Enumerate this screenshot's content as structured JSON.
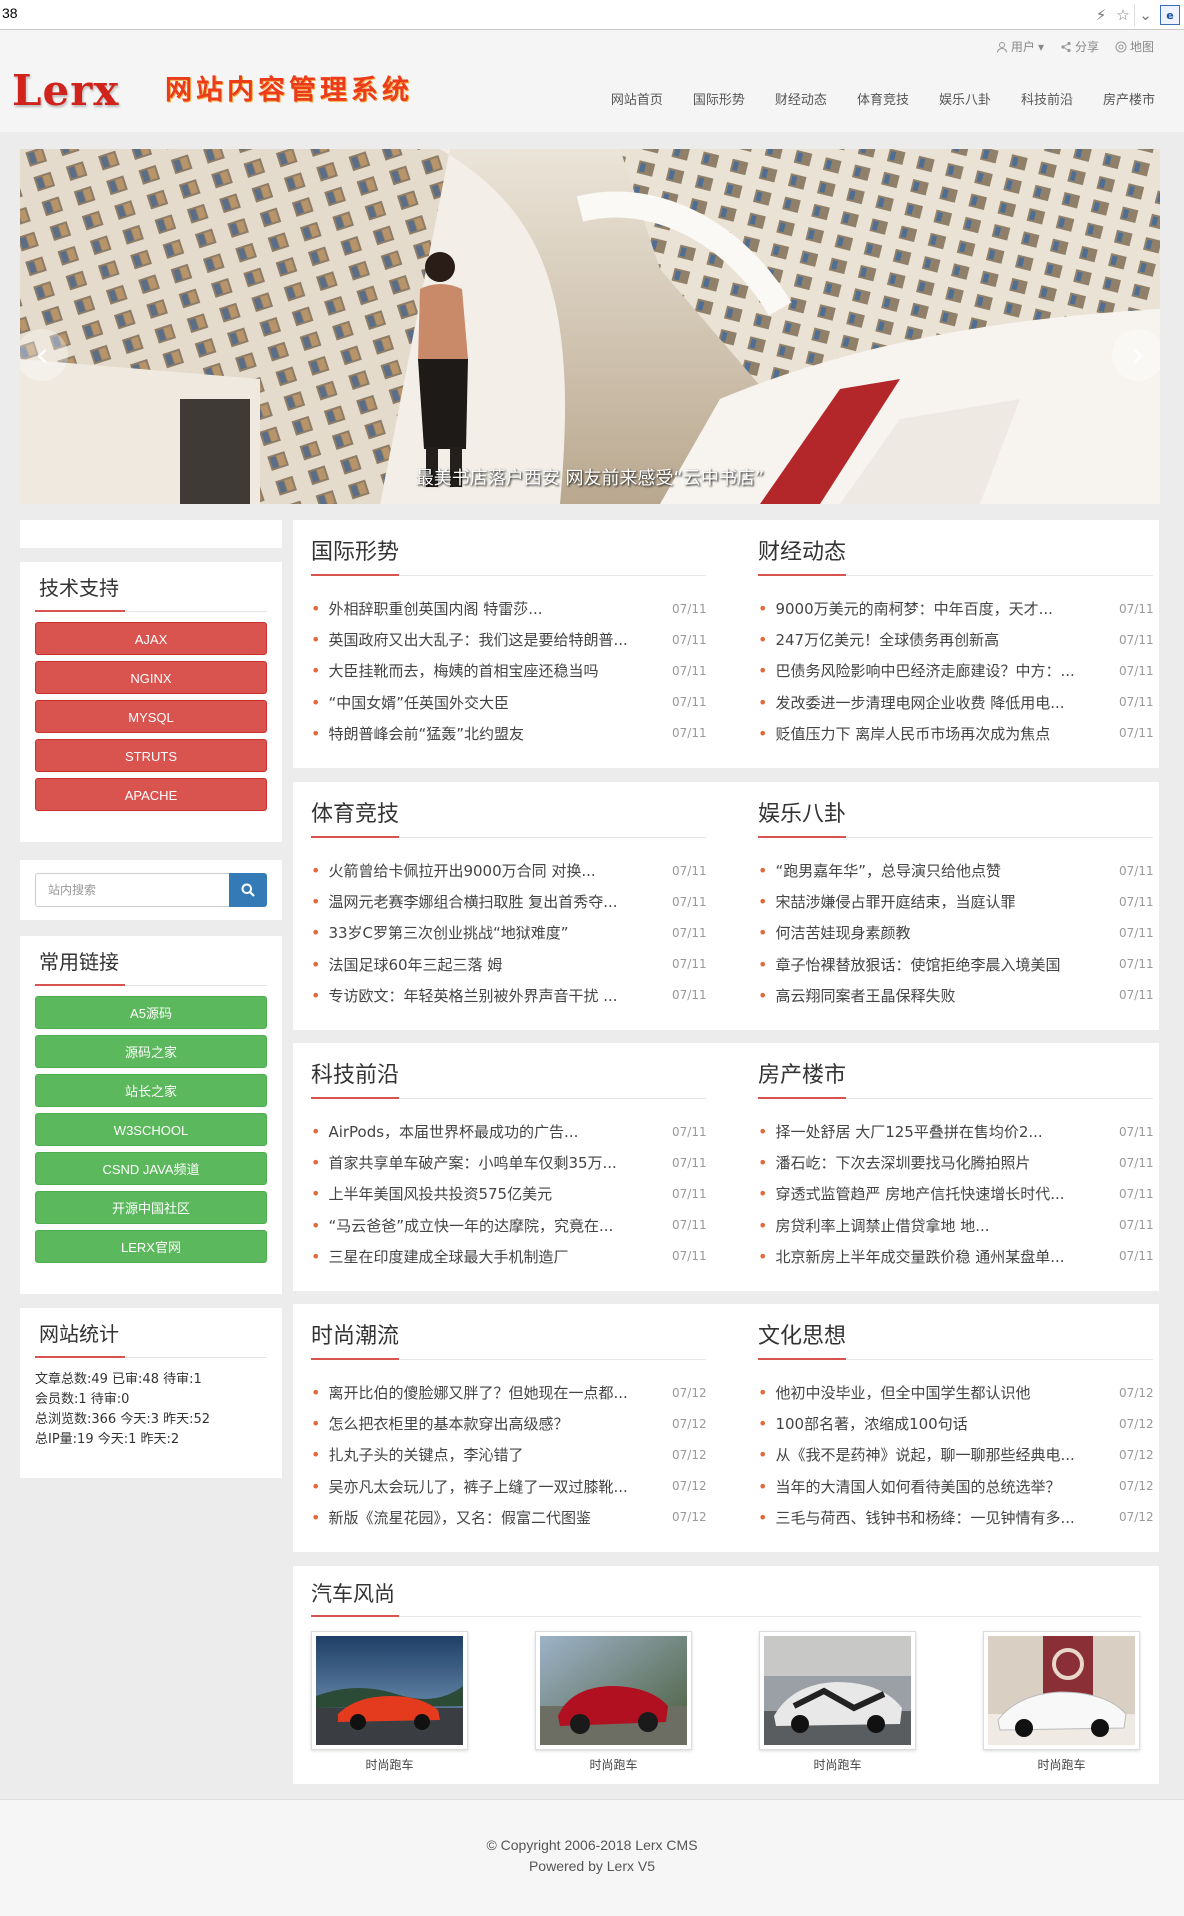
{
  "browser": {
    "url": "38",
    "icons": [
      "lightning-icon",
      "star-icon",
      "dropdown-icon",
      "ie-compat-icon"
    ]
  },
  "header": {
    "logo": "Lerx",
    "slogan": "网站内容管理系统",
    "topnav": {
      "user": "用户",
      "share": "分享",
      "map": "地图"
    },
    "nav": [
      "网站首页",
      "国际形势",
      "财经动态",
      "体育竞技",
      "娱乐八卦",
      "科技前沿",
      "房产楼市"
    ]
  },
  "banner": {
    "caption": "最美书店落户西安 网友前来感受“云中书店”"
  },
  "sidebar": {
    "tech": {
      "title": "技术支持",
      "items": [
        "AJAX",
        "NGINX",
        "MYSQL",
        "STRUTS",
        "APACHE"
      ]
    },
    "search": {
      "placeholder": "站内搜索"
    },
    "links": {
      "title": "常用链接",
      "items": [
        "A5源码",
        "源码之家",
        "站长之家",
        "W3SCHOOL",
        "CSND JAVA频道",
        "开源中国社区",
        "LERX官网"
      ]
    },
    "stats": {
      "title": "网站统计",
      "lines": [
        "文章总数:49 已审:48 待审:1",
        "会员数:1 待审:0",
        "总浏览数:366 今天:3 昨天:52",
        "总IP量:19 今天:1 昨天:2"
      ]
    }
  },
  "sections": [
    {
      "left": {
        "title": "国际形势",
        "items": [
          {
            "t": "外相辞职重创英国内阁 特雷莎...",
            "d": "07/11"
          },
          {
            "t": "英国政府又出大乱子：我们这是要给特朗普...",
            "d": "07/11"
          },
          {
            "t": "大臣挂靴而去，梅姨的首相宝座还稳当吗",
            "d": "07/11"
          },
          {
            "t": "“中国女婿”任英国外交大臣",
            "d": "07/11"
          },
          {
            "t": "特朗普峰会前“猛轰”北约盟友",
            "d": "07/11"
          }
        ]
      },
      "right": {
        "title": "财经动态",
        "items": [
          {
            "t": "9000万美元的南柯梦：中年百度，天才...",
            "d": "07/11"
          },
          {
            "t": "247万亿美元！全球债务再创新高",
            "d": "07/11"
          },
          {
            "t": "巴债务风险影响中巴经济走廊建设？中方：...",
            "d": "07/11"
          },
          {
            "t": "发改委进一步清理电网企业收费 降低用电...",
            "d": "07/11"
          },
          {
            "t": "贬值压力下 离岸人民币市场再次成为焦点",
            "d": "07/11"
          }
        ]
      }
    },
    {
      "left": {
        "title": "体育竞技",
        "items": [
          {
            "t": "火箭曾给卡佩拉开出9000万合同 对换...",
            "d": "07/11"
          },
          {
            "t": "温网元老赛李娜组合横扫取胜 复出首秀夺...",
            "d": "07/11"
          },
          {
            "t": "33岁C罗第三次创业挑战“地狱难度”",
            "d": "07/11"
          },
          {
            "t": "法国足球60年三起三落 姆",
            "d": "07/11"
          },
          {
            "t": "专访欧文：年轻英格兰别被外界声音干扰 ...",
            "d": "07/11"
          }
        ]
      },
      "right": {
        "title": "娱乐八卦",
        "items": [
          {
            "t": "“跑男嘉年华”，总导演只给他点赞",
            "d": "07/11"
          },
          {
            "t": "宋喆涉嫌侵占罪开庭结束，当庭认罪",
            "d": "07/11"
          },
          {
            "t": "何洁苦娃现身素颜教",
            "d": "07/11"
          },
          {
            "t": "章子怡裸替放狠话：使馆拒绝李晨入境美国",
            "d": "07/11"
          },
          {
            "t": "高云翔同案者王晶保释失败",
            "d": "07/11"
          }
        ]
      }
    },
    {
      "left": {
        "title": "科技前沿",
        "items": [
          {
            "t": "AirPods，本届世界杯最成功的广告...",
            "d": "07/11"
          },
          {
            "t": "首家共享单车破产案：小鸣单车仅剩35万...",
            "d": "07/11"
          },
          {
            "t": "上半年美国风投共投资575亿美元",
            "d": "07/11"
          },
          {
            "t": "“马云爸爸”成立快一年的达摩院，究竟在...",
            "d": "07/11"
          },
          {
            "t": "三星在印度建成全球最大手机制造厂",
            "d": "07/11"
          }
        ]
      },
      "right": {
        "title": "房产楼市",
        "items": [
          {
            "t": "择一处舒居 大厂125平叠拼在售均价2...",
            "d": "07/11"
          },
          {
            "t": "潘石屹：下次去深圳要找马化腾拍照片",
            "d": "07/11"
          },
          {
            "t": "穿透式监管趋严 房地产信托快速增长时代...",
            "d": "07/11"
          },
          {
            "t": "房贷利率上调禁止借贷拿地 地...",
            "d": "07/11"
          },
          {
            "t": "北京新房上半年成交量跌价稳 通州某盘单...",
            "d": "07/11"
          }
        ]
      }
    },
    {
      "left": {
        "title": "时尚潮流",
        "items": [
          {
            "t": "离开比伯的傻脸娜又胖了？但她现在一点都...",
            "d": "07/12"
          },
          {
            "t": "怎么把衣柜里的基本款穿出高级感？",
            "d": "07/12"
          },
          {
            "t": "扎丸子头的关键点，李沁错了",
            "d": "07/12"
          },
          {
            "t": "吴亦凡太会玩儿了，裤子上缝了一双过膝靴...",
            "d": "07/12"
          },
          {
            "t": "新版《流星花园》，又名：假富二代图鉴",
            "d": "07/12"
          }
        ]
      },
      "right": {
        "title": "文化思想",
        "items": [
          {
            "t": "他初中没毕业，但全中国学生都认识他",
            "d": "07/12"
          },
          {
            "t": "100部名著，浓缩成100句话",
            "d": "07/12"
          },
          {
            "t": "从《我不是药神》说起，聊一聊那些经典电...",
            "d": "07/12"
          },
          {
            "t": "当年的大清国人如何看待美国的总统选举？",
            "d": "07/12"
          },
          {
            "t": "三毛与荷西、钱钟书和杨绛：一见钟情有多...",
            "d": "07/12"
          }
        ]
      }
    }
  ],
  "cars": {
    "title": "汽车风尚",
    "items": [
      "时尚跑车",
      "时尚跑车",
      "时尚跑车",
      "时尚跑车"
    ]
  },
  "footer": {
    "copyright": "© Copyright 2006-2018 Lerx CMS",
    "powered": "Powered by Lerx V5"
  }
}
